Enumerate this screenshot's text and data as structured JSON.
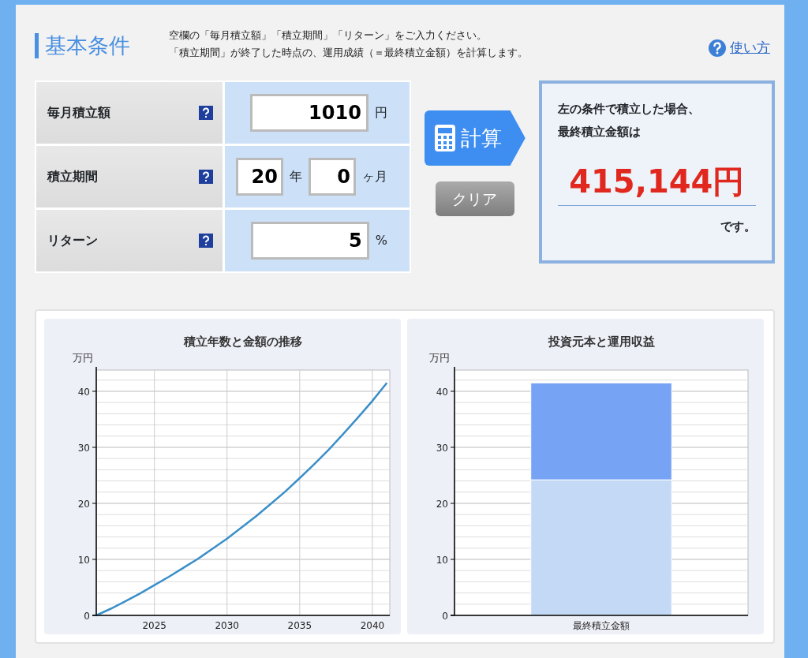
{
  "header": {
    "title": "基本条件",
    "instructions": [
      "空欄の「毎月積立額」「積立期間」「リターン」をご入力ください。",
      "「積立期間」が終了した時点の、運用成績（＝最終積立金額）を計算します。"
    ],
    "help_link": "使い方"
  },
  "form": {
    "rows": [
      {
        "label": "毎月積立額",
        "kind": "single",
        "fields": [
          {
            "value": "1010",
            "unit": "円"
          }
        ]
      },
      {
        "label": "積立期間",
        "kind": "pair",
        "fields": [
          {
            "value": "20",
            "unit": "年"
          },
          {
            "value": "0",
            "unit": "ヶ月"
          }
        ]
      },
      {
        "label": "リターン",
        "kind": "single",
        "fields": [
          {
            "value": "5",
            "unit": "%"
          }
        ]
      }
    ]
  },
  "buttons": {
    "calculate": "計算",
    "clear": "クリア"
  },
  "result": {
    "intro": [
      "左の条件で積立した場合、",
      "最終積立金額は"
    ],
    "amount": "415,144円",
    "suffix": "です。"
  },
  "charts": [
    {
      "chart_data": {
        "type": "line",
        "title": "積立年数と金額の推移",
        "ylabel": "万円",
        "x": [
          2021,
          2022,
          2023,
          2024,
          2025,
          2026,
          2027,
          2028,
          2029,
          2030,
          2031,
          2032,
          2033,
          2034,
          2035,
          2036,
          2037,
          2038,
          2039,
          2040,
          2041
        ],
        "series": [
          {
            "color": "#3a8fc8",
            "values": [
              0,
              1.2,
              2.5,
              3.9,
              5.4,
              6.9,
              8.5,
              10.1,
              11.9,
              13.7,
              15.7,
              17.7,
              19.9,
              22.1,
              24.5,
              27.0,
              29.6,
              32.4,
              35.3,
              38.3,
              41.5
            ]
          }
        ],
        "grid": true,
        "xlim": [
          2021,
          2041.2
        ],
        "ylim": [
          0,
          43.8
        ],
        "xticks": [
          2025,
          2030,
          2035,
          2040
        ],
        "yticks": [
          0,
          10,
          20,
          30,
          40
        ]
      }
    },
    {
      "chart_data": {
        "type": "bar",
        "title": "投資元本と運用収益",
        "ylabel": "万円",
        "categories": [
          "最終積立金額"
        ],
        "stacked": true,
        "series": [
          {
            "color": "#c3d9f5",
            "values": [
              24.2
            ]
          },
          {
            "color": "#77a3f5",
            "values": [
              17.3
            ]
          }
        ],
        "grid": true,
        "ylim": [
          0,
          43.8
        ],
        "yticks": [
          0,
          10,
          20,
          30,
          40
        ]
      }
    }
  ]
}
